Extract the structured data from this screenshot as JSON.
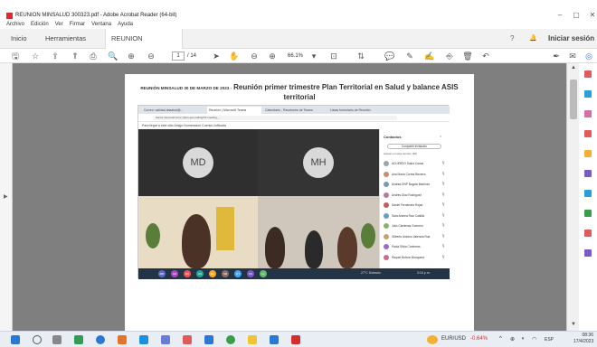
{
  "window": {
    "title": "REUNION MINSALUD 300323.pdf - Adobe Acrobat Reader (64-bit)",
    "controls": {
      "minimize": "–",
      "maximize": "▢",
      "close": "✕"
    }
  },
  "menu": [
    "Archivo",
    "Edición",
    "Ver",
    "Firmar",
    "Ventana",
    "Ayuda"
  ],
  "tabs": {
    "inicio": "Inicio",
    "herramientas": "Herramientas",
    "document": "REUNION MINSAL...",
    "close": "×",
    "signin": "Iniciar sesión"
  },
  "toolbar": {
    "page_current": "1",
    "page_total": "/ 14",
    "zoom": "66.1%"
  },
  "document": {
    "heading_small": "REUNIÓN MINSALUD 30 DE MARZO DE 2023 -",
    "heading_big_1": "Reunión primer trimestre Plan Territorial en Salud y balance ASIS",
    "heading_big_2": "territorial"
  },
  "screenshot": {
    "browser_tabs": [
      "Correo: calidad.dasalud@...",
      "Reunión | Microsoft Teams",
      "Calendario - Reuniones de Teams",
      "Listas formulario de Reunión"
    ],
    "url": "teams.microsoft.com/_#/pre-join-calling/19:meeting_...",
    "bookmarks": "Para llegar a este sitio   Amigo   Numeracion   Cuenta Unificada",
    "avatars": {
      "left": "MD",
      "right": "MH"
    },
    "contacts": {
      "header": "Contactos",
      "close": "×",
      "share_button": "Compartir invitación",
      "subheader": "Actuan en esta reunión (62)",
      "people": [
        {
          "name": "ACUERDO Salud Cauca",
          "color": "#9aa5b1"
        },
        {
          "name": "Ana María Correa Becerra",
          "color": "#c98b6b"
        },
        {
          "name": "Andrea DNP Bogotá Martínez",
          "color": "#7a9bb8"
        },
        {
          "name": "Andrés Díaz Rodríguez",
          "color": "#b87a9b"
        },
        {
          "name": "Daniel Fernández Rojas",
          "color": "#c65d5d"
        },
        {
          "name": "Sara Andrea Ruiz Castillo",
          "color": "#6b9bc9"
        },
        {
          "name": "Julio Cárdenas Guerrero",
          "color": "#8bb06b"
        },
        {
          "name": "Gilberto Antonio Valencia Rua",
          "color": "#c9a06b"
        },
        {
          "name": "Paola Silvia Contreras",
          "color": "#9b6bc9"
        },
        {
          "name": "Raquel Bolívar Mosquera",
          "color": "#c96b8b"
        }
      ]
    },
    "participant_chips": [
      {
        "label": "MD",
        "color": "#5c6bc0"
      },
      {
        "label": "GS",
        "color": "#ab47bc"
      },
      {
        "label": "DC",
        "color": "#ef5350"
      },
      {
        "label": "CS",
        "color": "#26a69a"
      },
      {
        "label": "ML",
        "color": "#ffa726"
      },
      {
        "label": "SB",
        "color": "#8d6e63"
      },
      {
        "label": "OT",
        "color": "#42a5f5"
      },
      {
        "label": "KS",
        "color": "#7e57c2"
      },
      {
        "label": "LL",
        "color": "#66bb6a"
      }
    ],
    "mini_tray": "27°C  Soleado",
    "mini_clock": "3:16 p.m."
  },
  "taskbar": {
    "ticker": "EUR/USD",
    "ticker_change": "-0.64%",
    "lang": "ESP",
    "time": "08:36",
    "date": "17/4/2023"
  },
  "colors": {
    "accent": "#2a6dd9",
    "document_background": "#7f7f7f",
    "negative": "#d32f2f"
  }
}
